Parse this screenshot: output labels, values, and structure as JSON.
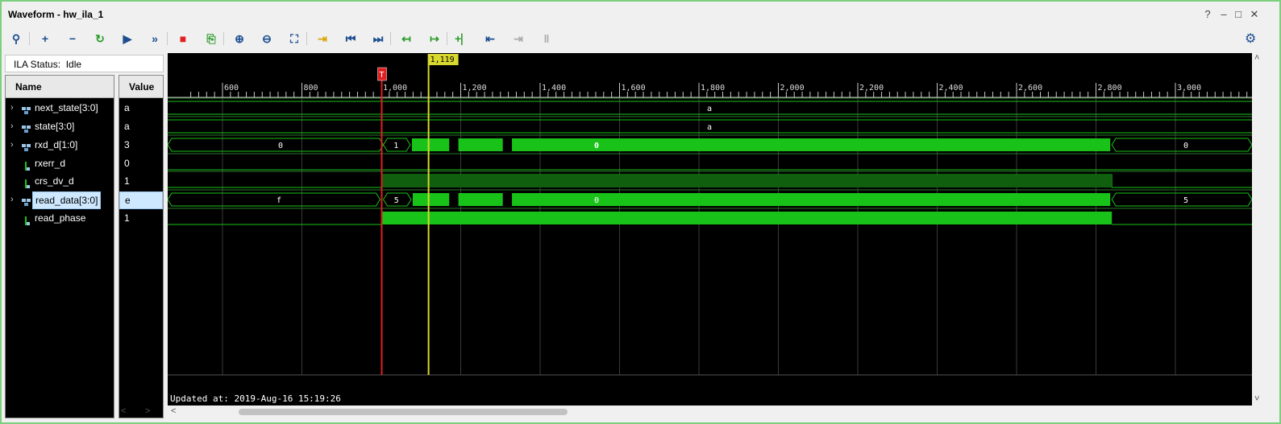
{
  "window": {
    "title": "Waveform - hw_ila_1",
    "controls": [
      "?",
      "–",
      "□",
      "✕"
    ]
  },
  "toolbar": {
    "items": [
      {
        "name": "search-icon",
        "glyph": "⚲",
        "color": "#1d4e8f"
      },
      {
        "name": "add-signal-icon",
        "glyph": "+",
        "color": "#1d4e8f"
      },
      {
        "name": "remove-signal-icon",
        "glyph": "−",
        "color": "#1d4e8f"
      },
      {
        "name": "rerun-icon",
        "glyph": "↻",
        "color": "#2a9a2a"
      },
      {
        "name": "run-trigger-icon",
        "glyph": "▶",
        "color": "#1d4e8f"
      },
      {
        "name": "run-immediate-icon",
        "glyph": "»",
        "color": "#1d4e8f"
      },
      {
        "name": "stop-icon",
        "glyph": "■",
        "color": "#e02020"
      },
      {
        "name": "export-icon",
        "glyph": "⎘",
        "color": "#2a9a2a"
      },
      {
        "name": "zoom-in-icon",
        "glyph": "⊕",
        "color": "#1d4e8f"
      },
      {
        "name": "zoom-out-icon",
        "glyph": "⊖",
        "color": "#1d4e8f"
      },
      {
        "name": "zoom-fit-icon",
        "glyph": "⛶",
        "color": "#1d4e8f"
      },
      {
        "name": "goto-cursor-icon",
        "glyph": "⇥",
        "color": "#d9a400"
      },
      {
        "name": "goto-start-icon",
        "glyph": "⏮",
        "color": "#1d4e8f"
      },
      {
        "name": "goto-end-icon",
        "glyph": "⏭",
        "color": "#1d4e8f"
      },
      {
        "name": "prev-transition-icon",
        "glyph": "↤",
        "color": "#2a9a2a"
      },
      {
        "name": "next-transition-icon",
        "glyph": "↦",
        "color": "#2a9a2a"
      },
      {
        "name": "add-marker-icon",
        "glyph": "+⎸",
        "color": "#2a9a2a"
      },
      {
        "name": "prev-marker-icon",
        "glyph": "⇤",
        "color": "#1d4e8f"
      },
      {
        "name": "next-marker-icon",
        "glyph": "⇥",
        "color": "#aaaaaa"
      },
      {
        "name": "swap-cursors-icon",
        "glyph": "‖",
        "color": "#aaaaaa"
      }
    ],
    "settings_icon": "⚙"
  },
  "ila_status": {
    "label": "ILA Status:",
    "value": "Idle"
  },
  "columns": {
    "name": "Name",
    "value": "Value"
  },
  "signals": [
    {
      "name": "next_state[3:0]",
      "value": "a",
      "bus": true,
      "expand": "›",
      "selected": false
    },
    {
      "name": "state[3:0]",
      "value": "a",
      "bus": true,
      "expand": "›",
      "selected": false
    },
    {
      "name": "rxd_d[1:0]",
      "value": "3",
      "bus": true,
      "expand": "›",
      "selected": false
    },
    {
      "name": "rxerr_d",
      "value": "0",
      "bus": false,
      "expand": "",
      "selected": false
    },
    {
      "name": "crs_dv_d",
      "value": "1",
      "bus": false,
      "expand": "",
      "selected": false
    },
    {
      "name": "read_data[3:0]",
      "value": "e",
      "bus": true,
      "expand": "›",
      "selected": true
    },
    {
      "name": "read_phase",
      "value": "1",
      "bus": false,
      "expand": "",
      "selected": false
    }
  ],
  "timeline": {
    "tick_labels": [
      "600",
      "800",
      "1,000",
      "1,200",
      "1,400",
      "1,600",
      "1,800",
      "2,000",
      "2,200",
      "2,400",
      "2,600",
      "2,800",
      "3,000"
    ],
    "trigger_marker": "T",
    "cursor_label": "1,119"
  },
  "waves": {
    "next_state": {
      "label": "a"
    },
    "state": {
      "label": "a"
    },
    "rxd_d": {
      "labels": [
        "0",
        "1",
        "0",
        "0"
      ]
    },
    "read_data": {
      "labels": [
        "f",
        "5",
        "0",
        "5"
      ]
    }
  },
  "updated_at": "Updated at: 2019-Aug-16 15:19:26",
  "colors": {
    "wave": "#19c219",
    "trigger": "#e02020",
    "cursor": "#d8d830",
    "grid": "#3a3a3a"
  }
}
